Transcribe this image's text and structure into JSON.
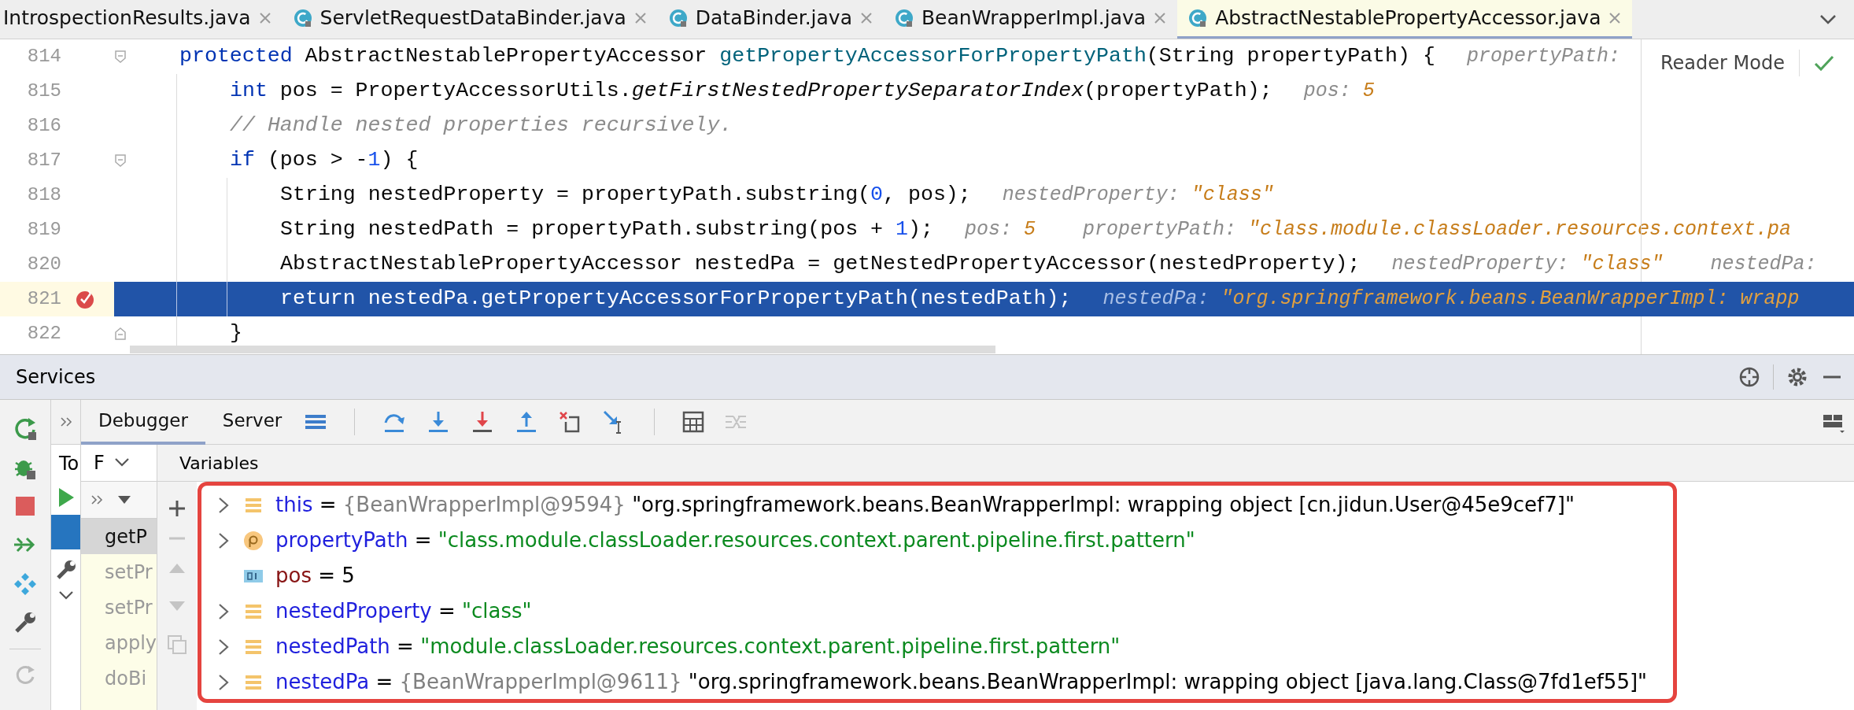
{
  "tabs": [
    {
      "label": "IntrospectionResults.java",
      "class_icon": false,
      "selected": false
    },
    {
      "label": "ServletRequestDataBinder.java",
      "class_icon": true,
      "selected": false
    },
    {
      "label": "DataBinder.java",
      "class_icon": true,
      "selected": false
    },
    {
      "label": "BeanWrapperImpl.java",
      "class_icon": true,
      "selected": false
    },
    {
      "label": "AbstractNestablePropertyAccessor.java",
      "class_icon": true,
      "selected": true
    }
  ],
  "editor": {
    "reader_mode": "Reader Mode",
    "lines": [
      {
        "number": "814",
        "fold_start": true,
        "fold_end": false,
        "breakpoint": false,
        "current": false,
        "tokens": [
          {
            "kind": "keyword",
            "text": "protected"
          },
          {
            "kind": "plain",
            "text": " AbstractNestablePropertyAccessor "
          },
          {
            "kind": "method",
            "text": "getPropertyAccessorForPropertyPath"
          },
          {
            "kind": "plain",
            "text": "(String propertyPath) {"
          }
        ],
        "hints": [
          {
            "label": "propertyPath:"
          }
        ],
        "children": [
          {
            "number": "815",
            "fold_start": false,
            "fold_end": false,
            "breakpoint": false,
            "current": false,
            "tokens": [
              {
                "kind": "keyword",
                "text": "int"
              },
              {
                "kind": "plain",
                "text": " pos = PropertyAccessorUtils."
              },
              {
                "kind": "static",
                "text": "getFirstNestedPropertySeparatorIndex"
              },
              {
                "kind": "plain",
                "text": "(propertyPath);"
              }
            ],
            "hints": [
              {
                "label": "pos:",
                "value": "5"
              }
            ]
          },
          {
            "number": "816",
            "fold_start": false,
            "fold_end": false,
            "breakpoint": false,
            "current": false,
            "tokens": [
              {
                "kind": "comment",
                "text": "// Handle nested properties recursively."
              }
            ]
          },
          {
            "number": "817",
            "fold_start": true,
            "fold_end": false,
            "breakpoint": false,
            "current": false,
            "tokens": [
              {
                "kind": "keyword",
                "text": "if"
              },
              {
                "kind": "plain",
                "text": " (pos > -"
              },
              {
                "kind": "number",
                "text": "1"
              },
              {
                "kind": "plain",
                "text": ") {"
              }
            ],
            "children": [
              {
                "number": "818",
                "fold_start": false,
                "fold_end": false,
                "breakpoint": false,
                "current": false,
                "tokens": [
                  {
                    "kind": "plain",
                    "text": "String nestedProperty = propertyPath.substring("
                  },
                  {
                    "kind": "number",
                    "text": "0"
                  },
                  {
                    "kind": "plain",
                    "text": ", pos);"
                  }
                ],
                "hints": [
                  {
                    "label": "nestedProperty:",
                    "value": "\"class\""
                  }
                ]
              },
              {
                "number": "819",
                "fold_start": false,
                "fold_end": false,
                "breakpoint": false,
                "current": false,
                "tokens": [
                  {
                    "kind": "plain",
                    "text": "String nestedPath = propertyPath.substring(pos + "
                  },
                  {
                    "kind": "number",
                    "text": "1"
                  },
                  {
                    "kind": "plain",
                    "text": ");"
                  }
                ],
                "hints": [
                  {
                    "label": "pos:",
                    "value": "5"
                  },
                  {
                    "label": "propertyPath:",
                    "value": "\"class.module.classLoader.resources.context.pa"
                  }
                ]
              },
              {
                "number": "820",
                "fold_start": false,
                "fold_end": false,
                "breakpoint": false,
                "current": false,
                "tokens": [
                  {
                    "kind": "plain",
                    "text": "AbstractNestablePropertyAccessor nestedPa = getNestedPropertyAccessor(nestedProperty);"
                  }
                ],
                "hints": [
                  {
                    "label": "nestedProperty:",
                    "value": "\"class\""
                  },
                  {
                    "label": "nestedPa:"
                  }
                ]
              },
              {
                "number": "821",
                "fold_start": false,
                "fold_end": false,
                "breakpoint": true,
                "current": true,
                "tokens": [
                  {
                    "kind": "keyword",
                    "text": "return"
                  },
                  {
                    "kind": "plain",
                    "text": " nestedPa.getPropertyAccessorForPropertyPath(nestedPath);"
                  }
                ],
                "hints": [
                  {
                    "label": "nestedPa:",
                    "value": "\"org.springframework.beans.BeanWrapperImpl: wrapp"
                  }
                ]
              }
            ]
          },
          {
            "number": "822",
            "fold_start": false,
            "fold_end": true,
            "breakpoint": false,
            "current": false,
            "tokens": [
              {
                "kind": "plain",
                "text": "}"
              }
            ]
          }
        ]
      }
    ]
  },
  "services": {
    "title": "Services",
    "toolbar_tabs": [
      {
        "label": "Debugger",
        "selected": true
      },
      {
        "label": "Server",
        "selected": false
      }
    ],
    "threads_header": "To",
    "frames": {
      "header": "F",
      "items": [
        {
          "label": "getP",
          "selected": true
        },
        {
          "label": "setPr",
          "selected": false
        },
        {
          "label": "setPr",
          "selected": false
        },
        {
          "label": "apply",
          "selected": false
        },
        {
          "label": "doBi",
          "selected": false
        }
      ]
    },
    "variables": {
      "header": "Variables",
      "rows": [
        {
          "kind": "object",
          "expandable": true,
          "name": "this",
          "equals": "=",
          "type": "{BeanWrapperImpl@9594}",
          "value": "\"org.springframework.beans.BeanWrapperImpl: wrapping object [cn.jidun.User@45e9cef7]\"",
          "string_value": false
        },
        {
          "kind": "parameter",
          "expandable": true,
          "name": "propertyPath",
          "equals": "=",
          "value": "\"class.module.classLoader.resources.context.parent.pipeline.first.pattern\"",
          "string_value": true
        },
        {
          "kind": "primitive",
          "expandable": false,
          "name": "pos",
          "equals": "=",
          "value": "5",
          "string_value": false
        },
        {
          "kind": "object",
          "expandable": true,
          "name": "nestedProperty",
          "equals": "=",
          "value": "\"class\"",
          "string_value": true
        },
        {
          "kind": "object",
          "expandable": true,
          "name": "nestedPath",
          "equals": "=",
          "value": "\"module.classLoader.resources.context.parent.pipeline.first.pattern\"",
          "string_value": true
        },
        {
          "kind": "object",
          "expandable": true,
          "name": "nestedPa",
          "equals": "=",
          "type": "{BeanWrapperImpl@9611}",
          "value": "\"org.springframework.beans.BeanWrapperImpl: wrapping object [java.lang.Class@7fd1ef55]\"",
          "string_value": false
        }
      ]
    }
  }
}
